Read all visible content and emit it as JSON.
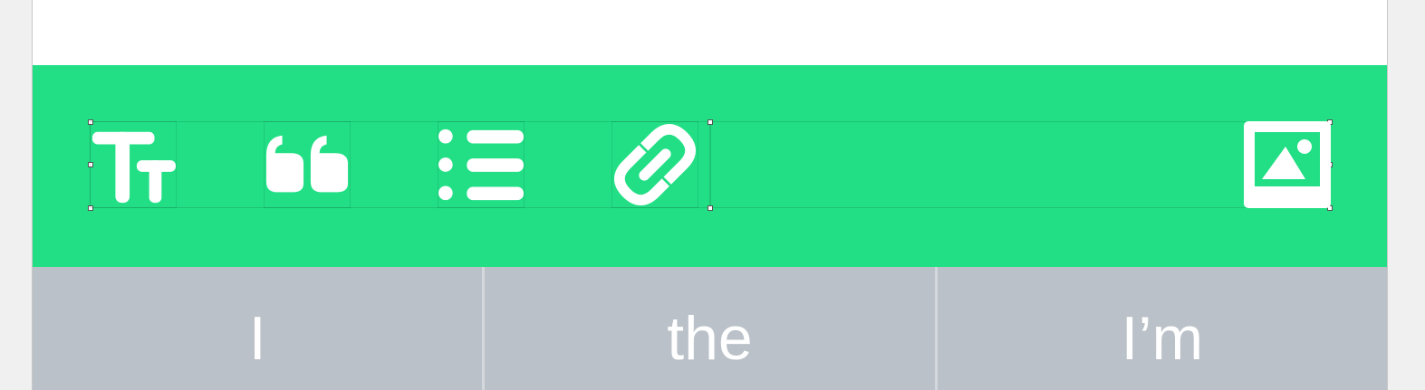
{
  "colors": {
    "toolbar_bg": "#22df85",
    "suggestion_bg": "#bac1c8",
    "icon": "#ffffff"
  },
  "toolbar": {
    "buttons": [
      {
        "name": "text-style",
        "icon": "text-size-icon"
      },
      {
        "name": "quote",
        "icon": "quote-icon"
      },
      {
        "name": "list",
        "icon": "bulleted-list-icon"
      },
      {
        "name": "link",
        "icon": "link-icon"
      },
      {
        "name": "image",
        "icon": "image-icon"
      }
    ]
  },
  "suggestions": [
    "I",
    "the",
    "I’m"
  ]
}
